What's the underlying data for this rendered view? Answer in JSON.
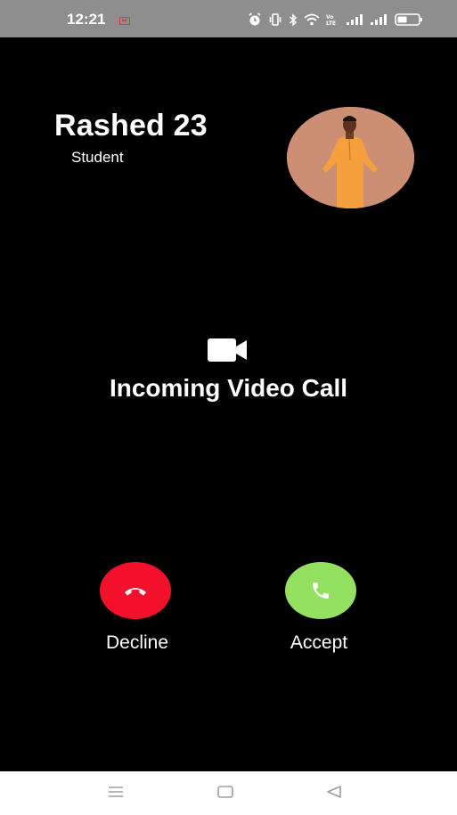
{
  "status_bar": {
    "time": "12:21",
    "icons": [
      "notification-icon",
      "alarm-icon",
      "vibrate-icon",
      "bluetooth-icon",
      "wifi-icon",
      "volte-icon",
      "signal-icon",
      "signal-icon",
      "battery-icon"
    ]
  },
  "caller": {
    "name": "Rashed 23",
    "subtitle": "Student"
  },
  "call": {
    "type_label": "Incoming Video Call",
    "decline_label": "Decline",
    "accept_label": "Accept"
  },
  "colors": {
    "decline": "#f2102b",
    "accept": "#94e162",
    "background": "#000000"
  },
  "nav_bar": {
    "items": [
      "menu-icon",
      "home-icon",
      "back-icon"
    ]
  }
}
